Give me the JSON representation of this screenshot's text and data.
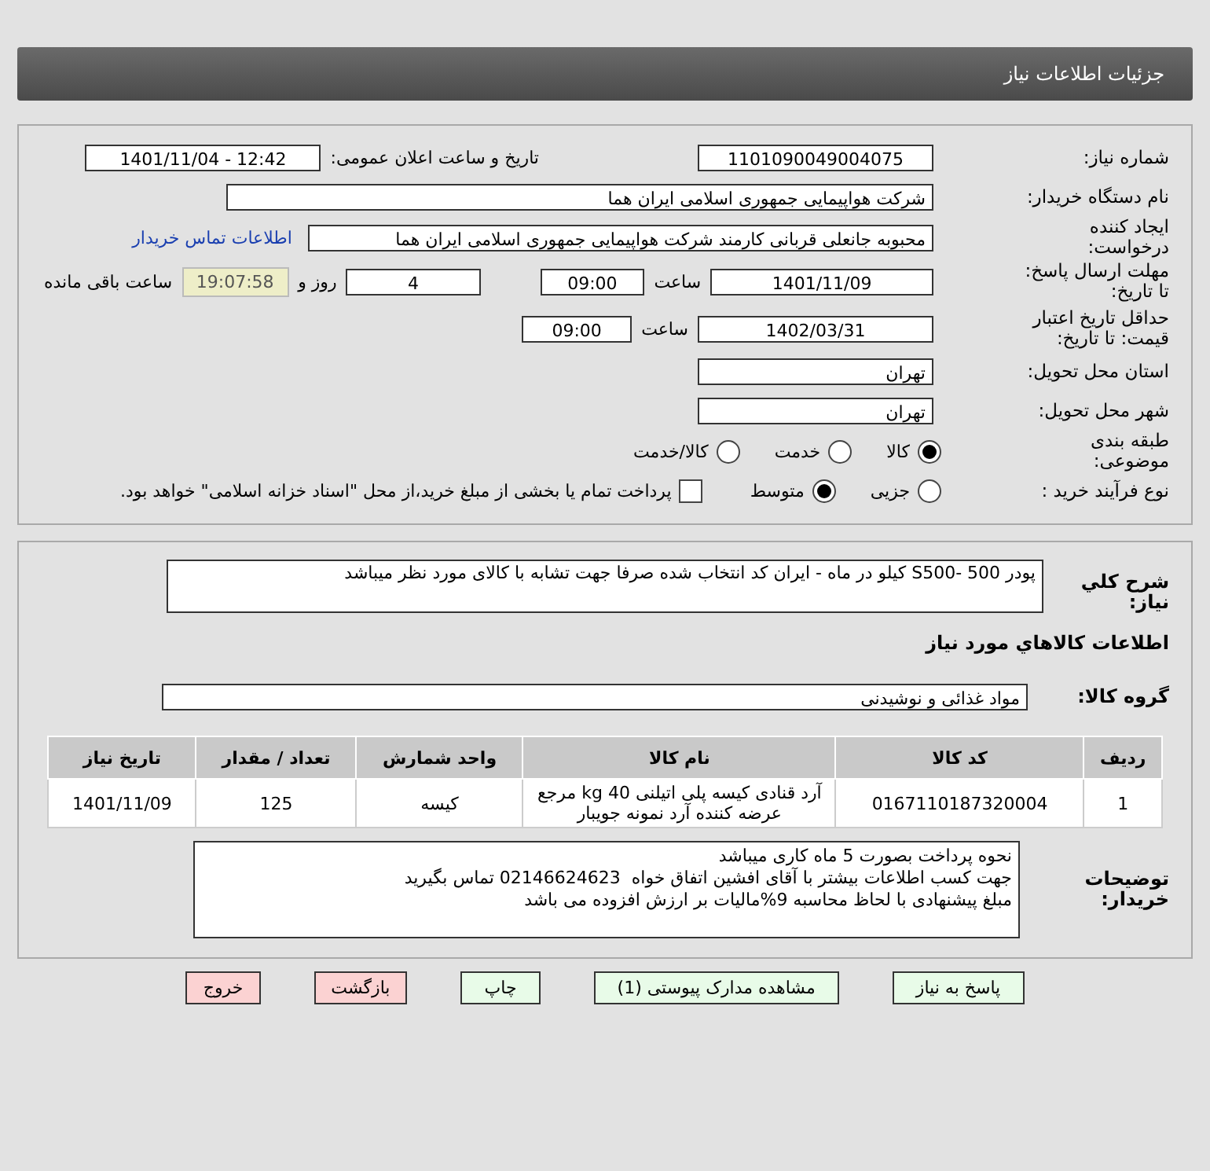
{
  "header": {
    "title": "جزئیات اطلاعات نیاز"
  },
  "details": {
    "need_number": {
      "label": "شماره نیاز:",
      "value": "1101090049004075"
    },
    "announce": {
      "label": "تاریخ و ساعت اعلان عمومی:",
      "value": "1401/11/04 - 12:42"
    },
    "buyer_org": {
      "label": "نام دستگاه خریدار:",
      "value": "شرکت هواپیمایی جمهوری اسلامی ایران هما"
    },
    "requester": {
      "label": "ایجاد کننده درخواست:",
      "value": "محبوبه جانعلی قربانی کارمند شرکت هواپیمایی جمهوری اسلامی ایران هما",
      "link": "اطلاعات تماس خریدار"
    },
    "deadline": {
      "label": "مهلت ارسال پاسخ: تا تاریخ:",
      "date": "1401/11/09",
      "time_label": "ساعت",
      "time": "09:00",
      "days": "4",
      "days_label": "روز و",
      "remaining": "19:07:58",
      "remaining_label": "ساعت باقی مانده"
    },
    "validity": {
      "label": "حداقل تاریخ اعتبار قیمت: تا تاریخ:",
      "date": "1402/03/31",
      "time_label": "ساعت",
      "time": "09:00"
    },
    "province": {
      "label": "استان محل تحویل:",
      "value": "تهران"
    },
    "city": {
      "label": "شهر محل تحویل:",
      "value": "تهران"
    },
    "category": {
      "label": "طبقه بندی موضوعی:",
      "options": [
        {
          "label": "کالا",
          "selected": true
        },
        {
          "label": "خدمت",
          "selected": false
        },
        {
          "label": "کالا/خدمت",
          "selected": false
        }
      ]
    },
    "process": {
      "label": "نوع فرآیند خرید :",
      "options": [
        {
          "label": "جزیی",
          "selected": false
        },
        {
          "label": "متوسط",
          "selected": true
        }
      ],
      "payment": {
        "checked": false,
        "text": "پرداخت تمام یا بخشی از مبلغ خرید،از محل \"اسناد خزانه اسلامی\" خواهد بود."
      }
    }
  },
  "summary": {
    "label": "شرح كلي نياز:",
    "value": "پودر 500 -S500 کیلو در ماه - ایران کد انتخاب شده صرفا جهت تشابه با کالای مورد نظر میباشد"
  },
  "goods_title": "اطلاعات كالاهاي مورد نياز",
  "goods_group": {
    "label": "گروه کالا:",
    "value": "مواد غذائی و نوشیدنی"
  },
  "table": {
    "columns": [
      "رديف",
      "کد کالا",
      "نام کالا",
      "واحد شمارش",
      "تعداد / مقدار",
      "تاریخ نیاز"
    ],
    "rows": [
      [
        "1",
        "0167110187320004",
        "آرد قنادی کیسه پلی اتیلنی 40 kg مرجع عرضه کننده آرد نمونه جویبار",
        "کیسه",
        "125",
        "1401/11/09"
      ]
    ]
  },
  "buyer_notes": {
    "label": "توضیحات خریدار:",
    "lines": [
      "نحوه پرداخت بصورت 5 ماه کاری میباشد",
      "جهت کسب اطلاعات بیشتر با آقای افشین اتفاق خواه  02146624623 تماس بگیرید",
      "مبلغ پیشنهادی با لحاظ محاسبه 9%مالیات بر ارزش افزوده می باشد"
    ]
  },
  "buttons": [
    {
      "label": "پاسخ به نیاز",
      "kind": "action"
    },
    {
      "label": "مشاهده مدارک پیوستی (1)",
      "kind": "action"
    },
    {
      "label": "چاپ",
      "kind": "action"
    },
    {
      "label": "بازگشت",
      "kind": "exit"
    },
    {
      "label": "خروج",
      "kind": "exit"
    }
  ]
}
